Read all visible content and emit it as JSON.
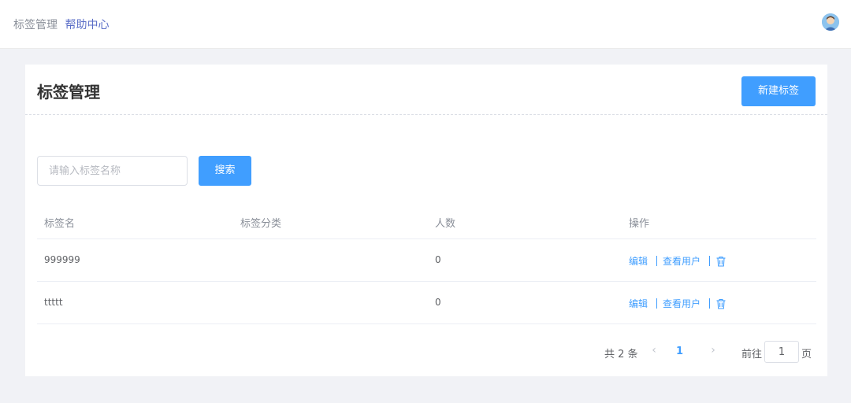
{
  "breadcrumb": {
    "current": "标签管理",
    "help": "帮助中心"
  },
  "page": {
    "title": "标签管理",
    "new_button": "新建标签"
  },
  "search": {
    "placeholder": "请输入标签名称",
    "value": "",
    "button": "搜索"
  },
  "table": {
    "columns": [
      "标签名",
      "标签分类",
      "人数",
      "操作"
    ],
    "rows": [
      {
        "name": "999999",
        "category": "",
        "count": "0",
        "actions": [
          "编辑",
          "查看用户"
        ]
      },
      {
        "name": "ttttt",
        "category": "",
        "count": "0",
        "actions": [
          "编辑",
          "查看用户"
        ]
      }
    ]
  },
  "pagination": {
    "total": "共 2 条",
    "current": "1",
    "goto_label": "前往",
    "goto_value": "1",
    "page_unit": "页"
  },
  "icons": {
    "avatar": "user-avatar-icon",
    "delete": "trash-icon",
    "prev": "chevron-left-icon",
    "next": "chevron-right-icon"
  },
  "colors": {
    "primary": "#409eff",
    "background": "#f1f2f6",
    "help_link": "#5b6ec7"
  }
}
